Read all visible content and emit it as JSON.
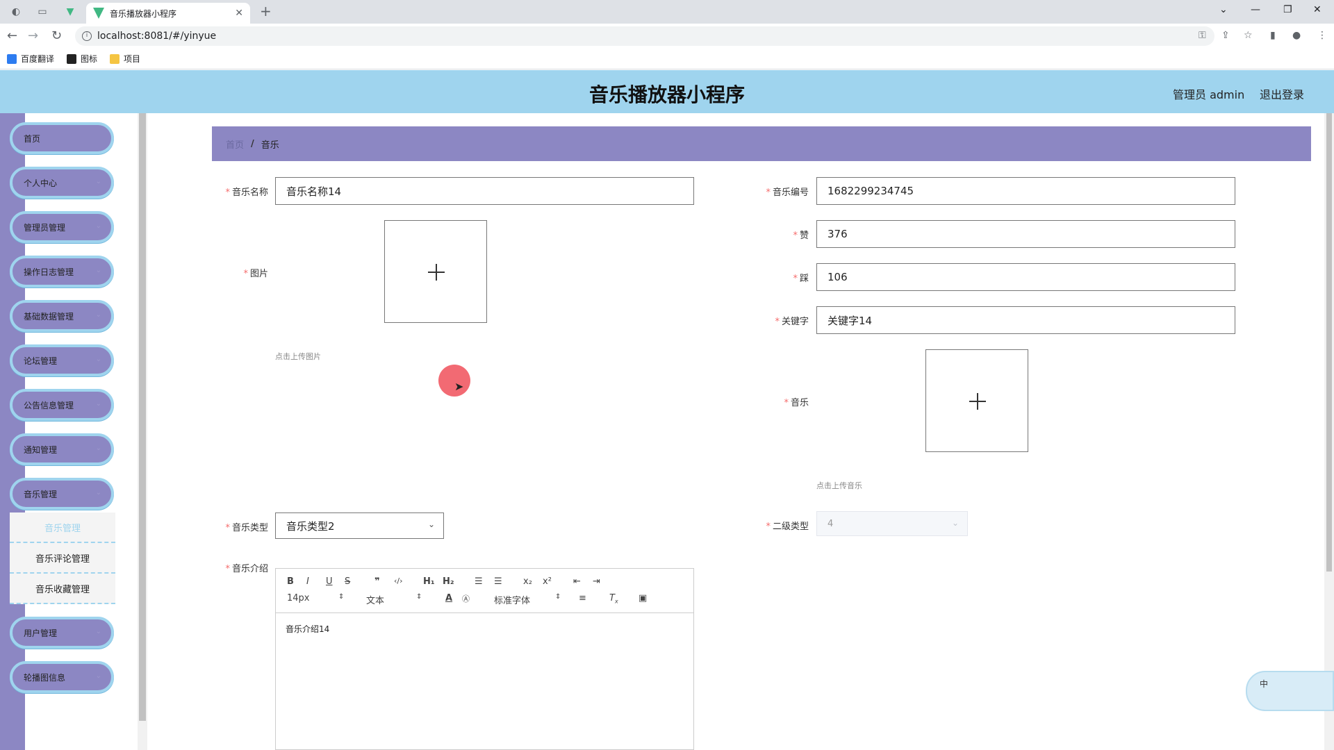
{
  "browser": {
    "tab_title": "音乐播放器小程序",
    "url": "localhost:8081/#/yinyue",
    "bookmarks": [
      {
        "label": "百度翻译",
        "color": "#2d7cf0"
      },
      {
        "label": "图标",
        "color": "#222222"
      },
      {
        "label": "项目",
        "color": "#f5c542"
      }
    ]
  },
  "header": {
    "title": "音乐播放器小程序",
    "user": "管理员 admin",
    "logout": "退出登录",
    "bg_color": "#9fd4ee"
  },
  "sidebar": {
    "items": [
      {
        "label": "首页",
        "has_chevron": false
      },
      {
        "label": "个人中心",
        "has_chevron": true
      },
      {
        "label": "管理员管理",
        "has_chevron": true
      },
      {
        "label": "操作日志管理",
        "has_chevron": true
      },
      {
        "label": "基础数据管理",
        "has_chevron": true
      },
      {
        "label": "论坛管理",
        "has_chevron": true
      },
      {
        "label": "公告信息管理",
        "has_chevron": true
      },
      {
        "label": "通知管理",
        "has_chevron": true
      },
      {
        "label": "音乐管理",
        "has_chevron": true
      }
    ],
    "submenu": [
      {
        "label": "音乐管理",
        "active": true
      },
      {
        "label": "音乐评论管理",
        "active": false
      },
      {
        "label": "音乐收藏管理",
        "active": false
      }
    ],
    "items_after": [
      {
        "label": "用户管理",
        "has_chevron": true
      },
      {
        "label": "轮播图信息",
        "has_chevron": true
      }
    ],
    "bg_color": "#8c87c3"
  },
  "breadcrumb": {
    "home": "首页",
    "separator": "/",
    "current": "音乐"
  },
  "form": {
    "music_name": {
      "label": "音乐名称",
      "value": "音乐名称14"
    },
    "image": {
      "label": "图片",
      "hint": "点击上传图片"
    },
    "music_no": {
      "label": "音乐编号",
      "value": "1682299234745"
    },
    "likes": {
      "label": "赞",
      "value": "376"
    },
    "dislikes": {
      "label": "踩",
      "value": "106"
    },
    "keyword": {
      "label": "关键字",
      "value": "关键字14"
    },
    "music_file": {
      "label": "音乐",
      "hint": "点击上传音乐"
    },
    "music_type": {
      "label": "音乐类型",
      "value": "音乐类型2"
    },
    "sub_type": {
      "label": "二级类型",
      "value": "4"
    },
    "intro": {
      "label": "音乐介绍",
      "content": "音乐介绍14",
      "toolbar": {
        "font_size": "14px",
        "header": "文本",
        "font_family": "标准字体"
      }
    }
  },
  "ime": {
    "label": "中"
  }
}
